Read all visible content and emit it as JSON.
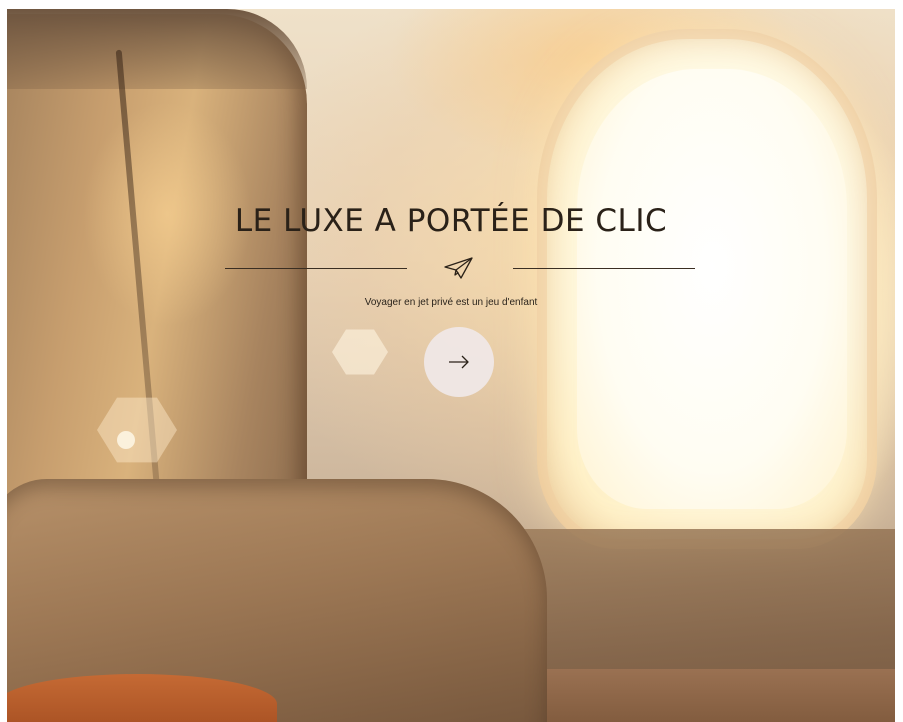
{
  "hero": {
    "title": "LE LUXE A PORTÉE DE CLIC",
    "subtitle": "Voyager en jet privé est un jeu d'enfant",
    "divider_icon": "paper-plane-icon",
    "cta_icon": "arrow-right-icon"
  }
}
